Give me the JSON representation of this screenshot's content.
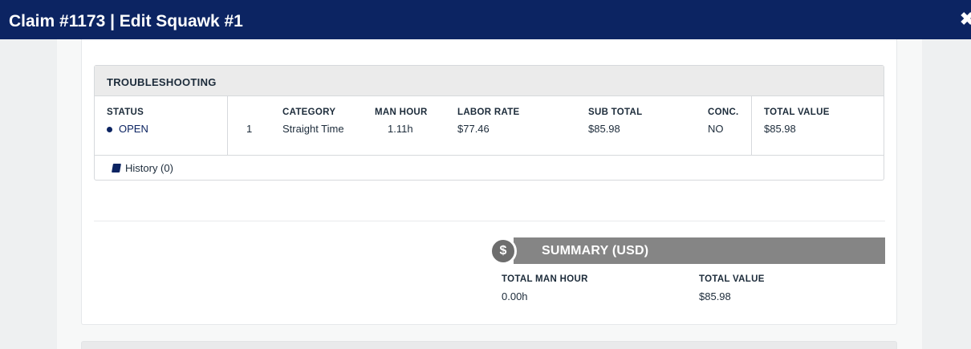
{
  "header": {
    "title": "Claim #1173 | Edit Squawk #1",
    "close_icon": "✖"
  },
  "troubleshooting": {
    "title": "TROUBLESHOOTING",
    "columns": {
      "status": "STATUS",
      "category": "CATEGORY",
      "man_hour": "MAN HOUR",
      "labor_rate": "LABOR RATE",
      "sub_total": "SUB TOTAL",
      "conc": "CONC.",
      "total_value": "TOTAL VALUE"
    },
    "row": {
      "status": "OPEN",
      "index": "1",
      "category": "Straight Time",
      "man_hour": "1.11h",
      "labor_rate": "$77.46",
      "sub_total": "$85.98",
      "conc": "NO",
      "total_value": "$85.98"
    },
    "history_link": "History (0)"
  },
  "summary": {
    "icon": "$",
    "title": "SUMMARY (USD)",
    "total_man_hour_label": "TOTAL MAN HOUR",
    "total_man_hour_value": "0.00h",
    "total_value_label": "TOTAL VALUE",
    "total_value_value": "$85.98"
  },
  "colors": {
    "header_bg": "#0c2462",
    "status_open": "#0c2462",
    "summary_bar": "#858585"
  }
}
